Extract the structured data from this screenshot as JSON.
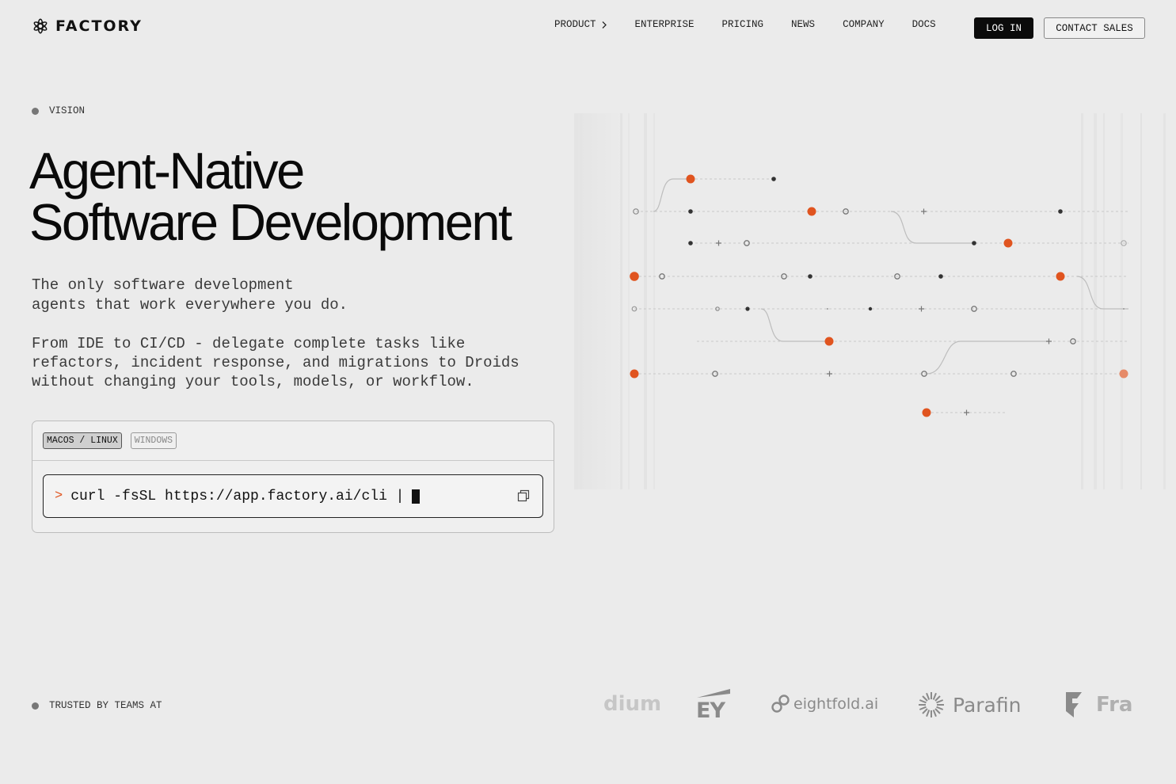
{
  "brand": {
    "name": "FACTORY"
  },
  "nav": {
    "items": [
      {
        "label": "PRODUCT",
        "has_chevron": true
      },
      {
        "label": "ENTERPRISE"
      },
      {
        "label": "PRICING"
      },
      {
        "label": "NEWS"
      },
      {
        "label": "COMPANY"
      },
      {
        "label": "DOCS"
      }
    ],
    "login_label": "LOG IN",
    "contact_label": "CONTACT SALES"
  },
  "hero": {
    "eyebrow": "VISION",
    "title_line1": "Agent-Native",
    "title_line2": "Software Development",
    "lede_line1": "The only software development",
    "lede_line2": "agents that work everywhere you do.",
    "body_line1": "From IDE to CI/CD - delegate complete tasks like",
    "body_line2": "refactors, incident response, and migrations to Droids",
    "body_line3": "without changing your tools, models, or workflow."
  },
  "install": {
    "tabs": [
      {
        "label": "MACOS / LINUX",
        "active": true
      },
      {
        "label": "WINDOWS",
        "active": false
      }
    ],
    "prompt": ">",
    "command": "curl -fsSL https://app.factory.ai/cli |",
    "copy_icon": "copy-icon"
  },
  "trusted": {
    "label": "TRUSTED BY TEAMS AT",
    "logos": [
      "dium",
      "EY",
      "eightfold.ai",
      "Parafin",
      "Fra"
    ]
  },
  "colors": {
    "accent": "#e0541f",
    "background": "#ebebeb",
    "text": "#111111",
    "muted": "#8a8a8a"
  }
}
